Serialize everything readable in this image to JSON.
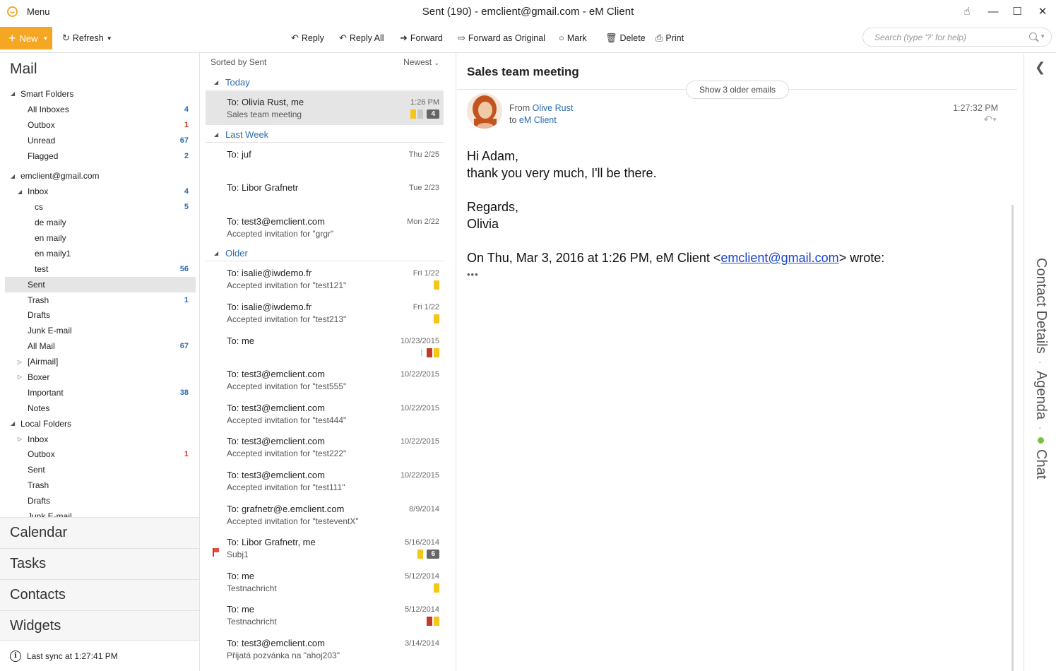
{
  "app": {
    "menu_label": "Menu",
    "window_title": "Sent (190) - emclient@gmail.com - eM Client"
  },
  "toolbar": {
    "new_label": "New",
    "refresh_label": "Refresh",
    "reply_label": "Reply",
    "reply_all_label": "Reply All",
    "forward_label": "Forward",
    "forward_original_label": "Forward as Original",
    "mark_label": "Mark",
    "delete_label": "Delete",
    "print_label": "Print",
    "search_placeholder": "Search (type '?' for help)"
  },
  "sidebar": {
    "title": "Mail",
    "tree": [
      {
        "label": "Smart Folders",
        "level": 0,
        "arrow": "open",
        "count": ""
      },
      {
        "label": "All Inboxes",
        "level": 1,
        "arrow": "",
        "count": "4"
      },
      {
        "label": "Outbox",
        "level": 1,
        "arrow": "",
        "count": "1",
        "red": true
      },
      {
        "label": "Unread",
        "level": 1,
        "arrow": "",
        "count": "67"
      },
      {
        "label": "Flagged",
        "level": 1,
        "arrow": "",
        "count": "2"
      },
      {
        "label": "",
        "level": 0,
        "arrow": "",
        "count": "",
        "spacer": true
      },
      {
        "label": "emclient@gmail.com",
        "level": 0,
        "arrow": "open",
        "count": ""
      },
      {
        "label": "Inbox",
        "level": 1,
        "arrow": "open",
        "count": "4"
      },
      {
        "label": "cs",
        "level": 2,
        "arrow": "",
        "count": "5"
      },
      {
        "label": "de maily",
        "level": 2,
        "arrow": "",
        "count": ""
      },
      {
        "label": "en maily",
        "level": 2,
        "arrow": "",
        "count": ""
      },
      {
        "label": "en maily1",
        "level": 2,
        "arrow": "",
        "count": ""
      },
      {
        "label": "test",
        "level": 2,
        "arrow": "",
        "count": "56"
      },
      {
        "label": "Sent",
        "level": 1,
        "arrow": "",
        "count": "",
        "selected": true
      },
      {
        "label": "Trash",
        "level": 1,
        "arrow": "",
        "count": "1"
      },
      {
        "label": "Drafts",
        "level": 1,
        "arrow": "",
        "count": ""
      },
      {
        "label": "Junk E-mail",
        "level": 1,
        "arrow": "",
        "count": ""
      },
      {
        "label": "All Mail",
        "level": 1,
        "arrow": "",
        "count": "67"
      },
      {
        "label": "[Airmail]",
        "level": 1,
        "arrow": "closed",
        "count": ""
      },
      {
        "label": "Boxer",
        "level": 1,
        "arrow": "closed",
        "count": ""
      },
      {
        "label": "Important",
        "level": 1,
        "arrow": "",
        "count": "38"
      },
      {
        "label": "Notes",
        "level": 1,
        "arrow": "",
        "count": ""
      },
      {
        "label": "Local Folders",
        "level": 0,
        "arrow": "open",
        "count": ""
      },
      {
        "label": "Inbox",
        "level": 1,
        "arrow": "closed",
        "count": ""
      },
      {
        "label": "Outbox",
        "level": 1,
        "arrow": "",
        "count": "1",
        "red": true
      },
      {
        "label": "Sent",
        "level": 1,
        "arrow": "",
        "count": ""
      },
      {
        "label": "Trash",
        "level": 1,
        "arrow": "",
        "count": ""
      },
      {
        "label": "Drafts",
        "level": 1,
        "arrow": "",
        "count": ""
      },
      {
        "label": "Junk E-mail",
        "level": 1,
        "arrow": "",
        "count": ""
      }
    ],
    "sections": [
      "Calendar",
      "Tasks",
      "Contacts",
      "Widgets"
    ],
    "sync_status": "Last sync at 1:27:41 PM"
  },
  "message_list": {
    "sorted_by": "Sorted by Sent",
    "order": "Newest",
    "groups": [
      {
        "label": "Today",
        "messages": [
          {
            "to": "To: Olivia Rust, me",
            "subject": "Sales team meeting",
            "date": "1:26 PM",
            "tags": [
              "yellow",
              "gray"
            ],
            "thread_count": "4",
            "selected": true
          }
        ]
      },
      {
        "label": "Last Week",
        "messages": [
          {
            "to": "To: juf",
            "subject": "",
            "date": "Thu 2/25",
            "tags": []
          },
          {
            "to": "To: Libor Grafnetr",
            "subject": "",
            "date": "Tue 2/23",
            "tags": []
          },
          {
            "to": "To: test3@emclient.com",
            "subject": "Accepted invitation for \"grgr\"",
            "date": "Mon 2/22",
            "tags": []
          }
        ]
      },
      {
        "label": "Older",
        "messages": [
          {
            "to": "To: isalie@iwdemo.fr",
            "subject": "Accepted invitation for \"test121\"",
            "date": "Fri 1/22",
            "tags": [
              "yellow"
            ]
          },
          {
            "to": "To: isalie@iwdemo.fr",
            "subject": "Accepted invitation for \"test213\"",
            "date": "Fri 1/22",
            "tags": [
              "yellow"
            ]
          },
          {
            "to": "To: me",
            "subject": "",
            "date": "10/23/2015",
            "tags": [
              "red",
              "yellow"
            ],
            "attachment": true
          },
          {
            "to": "To: test3@emclient.com",
            "subject": "Accepted invitation for \"test555\"",
            "date": "10/22/2015",
            "tags": []
          },
          {
            "to": "To: test3@emclient.com",
            "subject": "Accepted invitation for \"test444\"",
            "date": "10/22/2015",
            "tags": []
          },
          {
            "to": "To: test3@emclient.com",
            "subject": "Accepted invitation for \"test222\"",
            "date": "10/22/2015",
            "tags": []
          },
          {
            "to": "To: test3@emclient.com",
            "subject": "Accepted invitation for \"test111\"",
            "date": "10/22/2015",
            "tags": []
          },
          {
            "to": "To: grafnetr@e.emclient.com",
            "subject": "Accepted invitation for \"testeventX\"",
            "date": "8/9/2014",
            "tags": []
          },
          {
            "to": "To: Libor Grafnetr, me",
            "subject": "Subj1",
            "date": "5/16/2014",
            "tags": [
              "yellow"
            ],
            "thread_count": "6",
            "flagged": true
          },
          {
            "to": "To: me",
            "subject": "Testnachricht",
            "date": "5/12/2014",
            "tags": [
              "yellow"
            ]
          },
          {
            "to": "To: me",
            "subject": "Testnachricht",
            "date": "5/12/2014",
            "tags": [
              "red",
              "yellow"
            ]
          },
          {
            "to": "To: test3@emclient.com",
            "subject": "Přijatá pozvánka na \"ahoj203\"",
            "date": "3/14/2014",
            "tags": []
          }
        ]
      }
    ]
  },
  "reading_pane": {
    "subject": "Sales team meeting",
    "older_emails_label": "Show 3 older emails",
    "from_prefix": "From",
    "from_name": "Olive Rust",
    "to_prefix": "to",
    "to_name": "eM Client",
    "time": "1:27:32 PM",
    "body_lines": [
      "Hi Adam,",
      "thank you very much, I'll be there."
    ],
    "signoff_lines": [
      "Regards,",
      "Olivia"
    ],
    "quote_prefix": "On Thu, Mar 3, 2016 at 1:26 PM, eM Client <",
    "quote_email": "emclient@gmail.com",
    "quote_suffix": "> wrote:",
    "ellipsis": "•••"
  },
  "right_rail": {
    "contact_details": "Contact Details",
    "agenda": "Agenda",
    "chat": "Chat",
    "separator": "·"
  },
  "colors": {
    "accent": "#f5a623",
    "link": "#2b6cb0",
    "count_red": "#d0342c",
    "tag_yellow": "#f5c518",
    "tag_red": "#c0392b",
    "chat_green": "#7ac143"
  }
}
